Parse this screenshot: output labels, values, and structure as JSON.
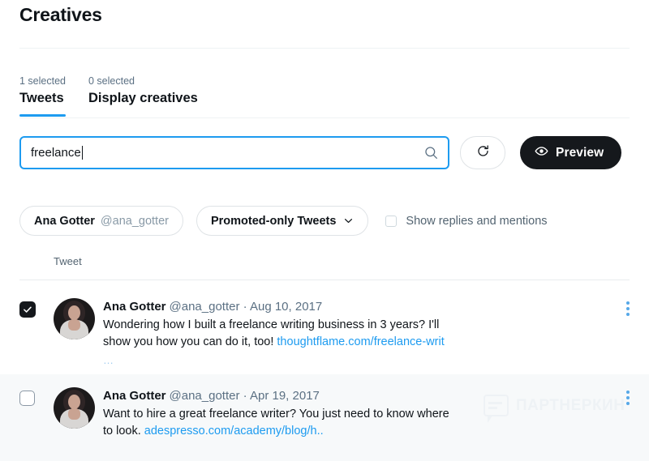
{
  "header": {
    "title": "Creatives"
  },
  "tabs": [
    {
      "count": "1 selected",
      "label": "Tweets",
      "active": true
    },
    {
      "count": "0 selected",
      "label": "Display creatives",
      "active": false
    }
  ],
  "search": {
    "value": "freelance",
    "placeholder": "",
    "icon": "search-icon"
  },
  "toolbar": {
    "refresh_icon": "refresh-icon",
    "preview_label": "Preview",
    "preview_icon": "eye-icon"
  },
  "filters": {
    "account": {
      "name": "Ana Gotter",
      "handle": "@ana_gotter"
    },
    "tweet_type": {
      "label": "Promoted-only Tweets",
      "icon": "chevron-down-icon"
    },
    "show_replies": {
      "label": "Show replies and mentions",
      "checked": false
    }
  },
  "table": {
    "column_header": "Tweet",
    "rows": [
      {
        "selected": true,
        "name": "Ana Gotter",
        "handle": "@ana_gotter",
        "separator": "·",
        "date": "Aug 10, 2017",
        "text": "Wondering how I built a freelance writing business in 3 years? I'll show you how you can do it, too! ",
        "link": "thoughtflame.com/freelance-writ",
        "ellipsis": "…",
        "menu_icon": "kebab-menu-icon"
      },
      {
        "selected": false,
        "name": "Ana Gotter",
        "handle": "@ana_gotter",
        "separator": "·",
        "date": "Apr 19, 2017",
        "text": "Want to hire a great freelance writer? You just need to know where to look. ",
        "link": "adespresso.com/academy/blog/h..",
        "ellipsis": "",
        "menu_icon": "kebab-menu-icon"
      }
    ]
  },
  "watermark": {
    "text": "ПАРТНЕРКИН",
    "icon": "chat-bubble-icon"
  },
  "colors": {
    "accent": "#1d9bf0",
    "text_primary": "#0f1419",
    "text_secondary": "#5b7083",
    "button_dark": "#15181c",
    "row_alt_bg": "#f7f9fa"
  }
}
